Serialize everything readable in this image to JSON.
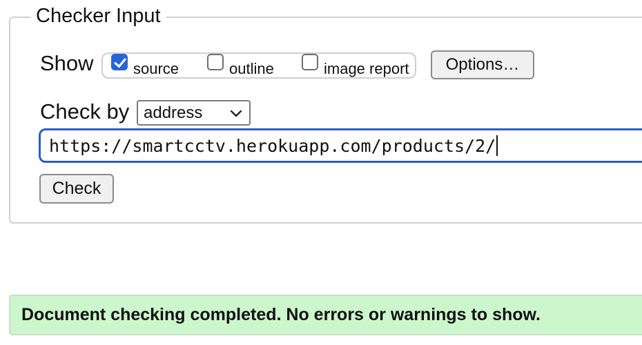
{
  "checker": {
    "legend": "Checker Input",
    "show_label": "Show",
    "show_options": [
      {
        "label": "source",
        "checked": true
      },
      {
        "label": "outline",
        "checked": false
      },
      {
        "label": "image report",
        "checked": false
      }
    ],
    "options_button": "Options…",
    "check_by_label": "Check by",
    "check_by_selected": "address",
    "url_value": "https://smartcctv.herokuapp.com/products/2/",
    "check_button": "Check"
  },
  "status": {
    "message": "Document checking completed. No errors or warnings to show."
  },
  "colors": {
    "accent": "#2764d8",
    "input_focus": "#2a5fc4",
    "success_bg": "#ccf7cc"
  },
  "icons": {
    "select": "chevron-down-icon",
    "checkbox": "checkmark-icon"
  }
}
